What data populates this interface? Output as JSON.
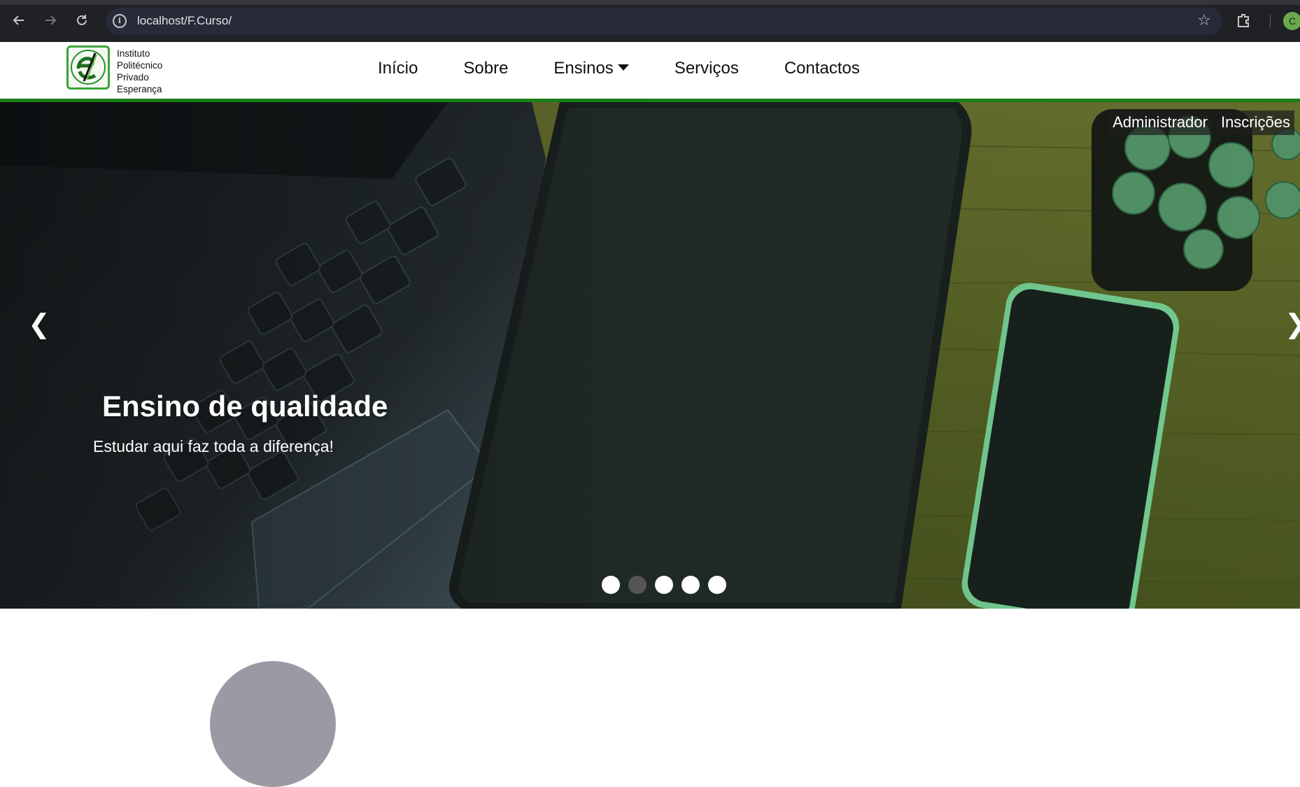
{
  "browser": {
    "url": "localhost/F.Curso/",
    "profile_initial": "C"
  },
  "header": {
    "logo_lines": [
      "Instituto",
      "Politécnico",
      "Privado",
      "Esperança"
    ],
    "nav": [
      {
        "label": "Início"
      },
      {
        "label": "Sobre"
      },
      {
        "label": "Ensinos"
      },
      {
        "label": "Serviços"
      },
      {
        "label": "Contactos"
      }
    ]
  },
  "hero": {
    "top_links": {
      "admin": "Administrador",
      "enroll": "Inscrições"
    },
    "prev_arrow": "❮",
    "next_arrow": "❯",
    "title": "Ensino de qualidade",
    "subtitle": "Estudar aqui faz toda a diferença!",
    "slide_count": 5,
    "active_slide": 2
  },
  "colors": {
    "accent_green": "#1b7d1b",
    "chrome_bg": "#202124",
    "omnibox_bg": "#282a3a"
  }
}
